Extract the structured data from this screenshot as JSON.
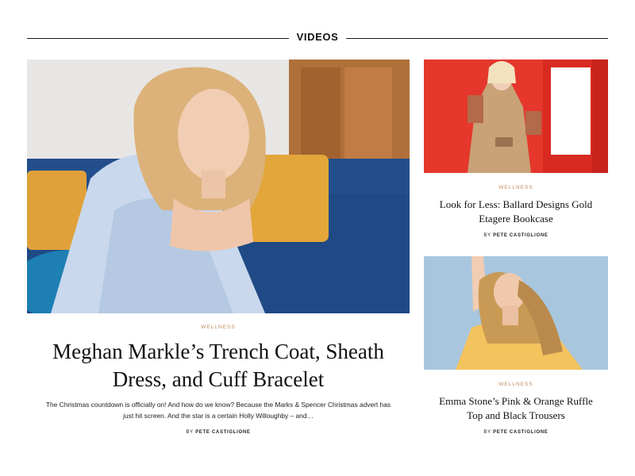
{
  "section": {
    "title": "VIDEOS"
  },
  "featured": {
    "category": "WELLNESS",
    "headline": "Meghan Markle’s Trench Coat, Sheath Dress, and Cuff Bracelet",
    "excerpt": "The Christmas countdown is officially on! And how do we know? Because the Marks & Spencer Christmas advert has just hit screen. And the star is a certain Holly Willoughby – and…",
    "byline_prefix": "BY",
    "author": "PETE CASTIGLIONE"
  },
  "sidebar": [
    {
      "category": "WELLNESS",
      "headline": "Look for Less: Ballard Designs Gold Etagere Bookcase",
      "byline_prefix": "BY",
      "author": "PETE CASTIGLIONE"
    },
    {
      "category": "WELLNESS",
      "headline": "Emma Stone’s Pink & Orange Ruffle Top and Black Trousers",
      "byline_prefix": "BY",
      "author": "PETE CASTIGLIONE"
    }
  ],
  "colors": {
    "accent": "#c08a5a",
    "text": "#111111",
    "rule": "#1a1a1a"
  }
}
